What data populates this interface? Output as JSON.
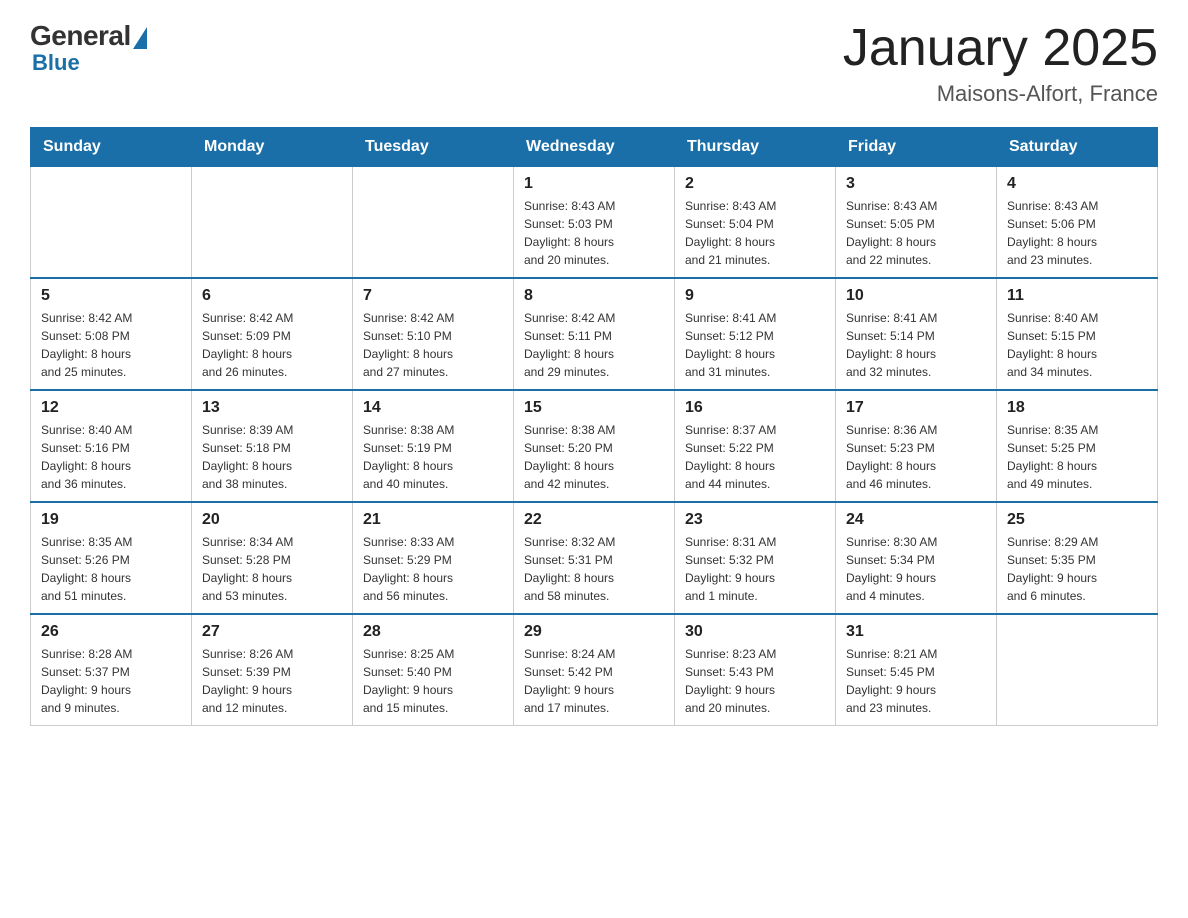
{
  "logo": {
    "general": "General",
    "blue": "Blue"
  },
  "calendar": {
    "title": "January 2025",
    "location": "Maisons-Alfort, France",
    "days_of_week": [
      "Sunday",
      "Monday",
      "Tuesday",
      "Wednesday",
      "Thursday",
      "Friday",
      "Saturday"
    ],
    "weeks": [
      [
        {
          "date": "",
          "info": ""
        },
        {
          "date": "",
          "info": ""
        },
        {
          "date": "",
          "info": ""
        },
        {
          "date": "1",
          "info": "Sunrise: 8:43 AM\nSunset: 5:03 PM\nDaylight: 8 hours\nand 20 minutes."
        },
        {
          "date": "2",
          "info": "Sunrise: 8:43 AM\nSunset: 5:04 PM\nDaylight: 8 hours\nand 21 minutes."
        },
        {
          "date": "3",
          "info": "Sunrise: 8:43 AM\nSunset: 5:05 PM\nDaylight: 8 hours\nand 22 minutes."
        },
        {
          "date": "4",
          "info": "Sunrise: 8:43 AM\nSunset: 5:06 PM\nDaylight: 8 hours\nand 23 minutes."
        }
      ],
      [
        {
          "date": "5",
          "info": "Sunrise: 8:42 AM\nSunset: 5:08 PM\nDaylight: 8 hours\nand 25 minutes."
        },
        {
          "date": "6",
          "info": "Sunrise: 8:42 AM\nSunset: 5:09 PM\nDaylight: 8 hours\nand 26 minutes."
        },
        {
          "date": "7",
          "info": "Sunrise: 8:42 AM\nSunset: 5:10 PM\nDaylight: 8 hours\nand 27 minutes."
        },
        {
          "date": "8",
          "info": "Sunrise: 8:42 AM\nSunset: 5:11 PM\nDaylight: 8 hours\nand 29 minutes."
        },
        {
          "date": "9",
          "info": "Sunrise: 8:41 AM\nSunset: 5:12 PM\nDaylight: 8 hours\nand 31 minutes."
        },
        {
          "date": "10",
          "info": "Sunrise: 8:41 AM\nSunset: 5:14 PM\nDaylight: 8 hours\nand 32 minutes."
        },
        {
          "date": "11",
          "info": "Sunrise: 8:40 AM\nSunset: 5:15 PM\nDaylight: 8 hours\nand 34 minutes."
        }
      ],
      [
        {
          "date": "12",
          "info": "Sunrise: 8:40 AM\nSunset: 5:16 PM\nDaylight: 8 hours\nand 36 minutes."
        },
        {
          "date": "13",
          "info": "Sunrise: 8:39 AM\nSunset: 5:18 PM\nDaylight: 8 hours\nand 38 minutes."
        },
        {
          "date": "14",
          "info": "Sunrise: 8:38 AM\nSunset: 5:19 PM\nDaylight: 8 hours\nand 40 minutes."
        },
        {
          "date": "15",
          "info": "Sunrise: 8:38 AM\nSunset: 5:20 PM\nDaylight: 8 hours\nand 42 minutes."
        },
        {
          "date": "16",
          "info": "Sunrise: 8:37 AM\nSunset: 5:22 PM\nDaylight: 8 hours\nand 44 minutes."
        },
        {
          "date": "17",
          "info": "Sunrise: 8:36 AM\nSunset: 5:23 PM\nDaylight: 8 hours\nand 46 minutes."
        },
        {
          "date": "18",
          "info": "Sunrise: 8:35 AM\nSunset: 5:25 PM\nDaylight: 8 hours\nand 49 minutes."
        }
      ],
      [
        {
          "date": "19",
          "info": "Sunrise: 8:35 AM\nSunset: 5:26 PM\nDaylight: 8 hours\nand 51 minutes."
        },
        {
          "date": "20",
          "info": "Sunrise: 8:34 AM\nSunset: 5:28 PM\nDaylight: 8 hours\nand 53 minutes."
        },
        {
          "date": "21",
          "info": "Sunrise: 8:33 AM\nSunset: 5:29 PM\nDaylight: 8 hours\nand 56 minutes."
        },
        {
          "date": "22",
          "info": "Sunrise: 8:32 AM\nSunset: 5:31 PM\nDaylight: 8 hours\nand 58 minutes."
        },
        {
          "date": "23",
          "info": "Sunrise: 8:31 AM\nSunset: 5:32 PM\nDaylight: 9 hours\nand 1 minute."
        },
        {
          "date": "24",
          "info": "Sunrise: 8:30 AM\nSunset: 5:34 PM\nDaylight: 9 hours\nand 4 minutes."
        },
        {
          "date": "25",
          "info": "Sunrise: 8:29 AM\nSunset: 5:35 PM\nDaylight: 9 hours\nand 6 minutes."
        }
      ],
      [
        {
          "date": "26",
          "info": "Sunrise: 8:28 AM\nSunset: 5:37 PM\nDaylight: 9 hours\nand 9 minutes."
        },
        {
          "date": "27",
          "info": "Sunrise: 8:26 AM\nSunset: 5:39 PM\nDaylight: 9 hours\nand 12 minutes."
        },
        {
          "date": "28",
          "info": "Sunrise: 8:25 AM\nSunset: 5:40 PM\nDaylight: 9 hours\nand 15 minutes."
        },
        {
          "date": "29",
          "info": "Sunrise: 8:24 AM\nSunset: 5:42 PM\nDaylight: 9 hours\nand 17 minutes."
        },
        {
          "date": "30",
          "info": "Sunrise: 8:23 AM\nSunset: 5:43 PM\nDaylight: 9 hours\nand 20 minutes."
        },
        {
          "date": "31",
          "info": "Sunrise: 8:21 AM\nSunset: 5:45 PM\nDaylight: 9 hours\nand 23 minutes."
        },
        {
          "date": "",
          "info": ""
        }
      ]
    ]
  }
}
